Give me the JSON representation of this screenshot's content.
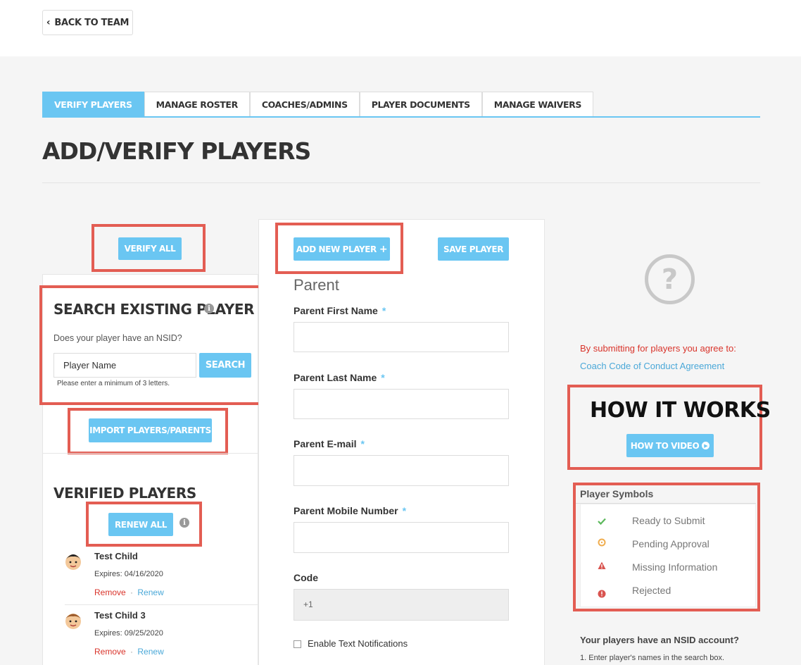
{
  "back_button": {
    "label": "BACK TO TEAM"
  },
  "tabs": [
    {
      "label": "VERIFY PLAYERS",
      "active": true
    },
    {
      "label": "MANAGE ROSTER",
      "active": false
    },
    {
      "label": "COACHES/ADMINS",
      "active": false
    },
    {
      "label": "PLAYER DOCUMENTS",
      "active": false
    },
    {
      "label": "MANAGE WAIVERS",
      "active": false
    }
  ],
  "page_title": "ADD/VERIFY PLAYERS",
  "left": {
    "verify_all_label": "VERIFY ALL",
    "search_title": "SEARCH EXISTING PLAYER",
    "nsid_question": "Does your player have an NSID?",
    "player_name_value": "Player Name",
    "search_label": "SEARCH",
    "hint": "Please enter a minimum of 3 letters.",
    "import_label": "IMPORT PLAYERS/PARENTS",
    "verified_title": "VERIFIED PLAYERS",
    "renew_all_label": "RENEW ALL",
    "players": [
      {
        "name": "Test Child",
        "expires": "Expires: 04/16/2020",
        "remove": "Remove",
        "sep": "·",
        "renew": "Renew"
      },
      {
        "name": "Test Child 3",
        "expires": "Expires: 09/25/2020",
        "remove": "Remove",
        "sep": "·",
        "renew": "Renew"
      }
    ]
  },
  "middle": {
    "add_new_label": "ADD NEW PLAYER",
    "save_label": "SAVE PLAYER",
    "section_title": "Parent",
    "fields": {
      "first_name": "Parent First Name",
      "last_name": "Parent Last Name",
      "email": "Parent E-mail",
      "mobile": "Parent Mobile Number",
      "required_mark": "*"
    },
    "code_label": "Code",
    "code_value": "+1",
    "text_notifications": "Enable Text Notifications"
  },
  "right": {
    "agree_text": "By submitting for players you agree to:",
    "conduct_link": "Coach Code of Conduct Agreement",
    "how_it_works": "HOW IT WORKS",
    "how_to_video": "HOW TO VIDEO",
    "symbols_title": "Player Symbols",
    "symbols": [
      {
        "label": "Ready to Submit",
        "color": "#5cb85c"
      },
      {
        "label": "Pending Approval",
        "color": "#f0ad4e"
      },
      {
        "label": "Missing Information",
        "color": "#d9534f"
      },
      {
        "label": "Rejected",
        "color": "#d9534f"
      }
    ],
    "nsid_account_question": "Your players have an NSID account?",
    "nsid_step": "1. Enter player's names in the search box."
  },
  "colors": {
    "accent": "#6ac6f2",
    "highlight": "#e35d53",
    "link_red": "#d9342b",
    "link_blue": "#4aa8d8"
  }
}
